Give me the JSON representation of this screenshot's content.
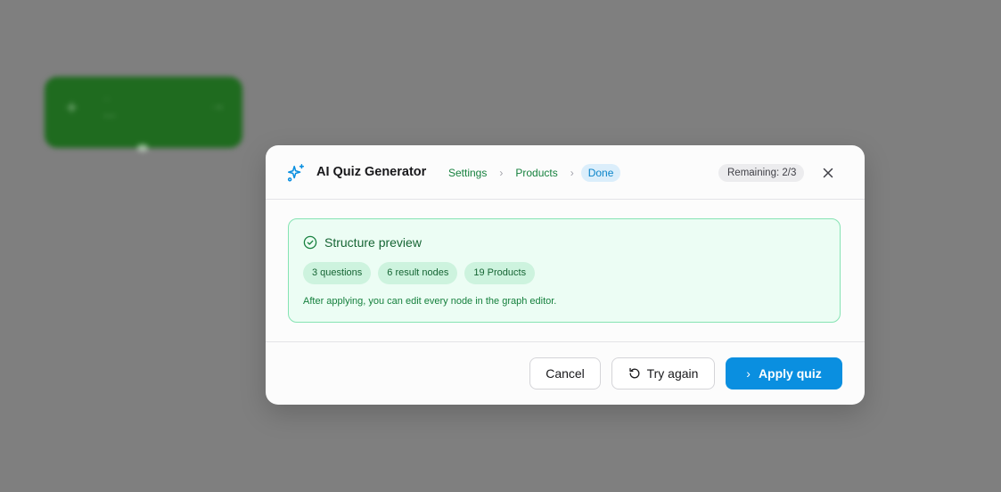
{
  "background": {
    "node": {
      "plus": "+",
      "small_label": "...",
      "title": "...",
      "arrow": "→"
    }
  },
  "modal": {
    "title": "AI Quiz Generator",
    "icon": "sparkles-icon",
    "steps": [
      {
        "label": "Settings",
        "state": "completed"
      },
      {
        "label": "Products",
        "state": "completed"
      },
      {
        "label": "Done",
        "state": "active"
      }
    ],
    "step_separator": "›",
    "remaining": "Remaining: 2/3",
    "close_icon": "close-icon"
  },
  "preview": {
    "title": "Structure preview",
    "icon": "check-circle-icon",
    "chips": [
      "3 questions",
      "6 result nodes",
      "19 Products"
    ],
    "note": "After applying, you can edit every node in the graph editor."
  },
  "footer": {
    "cancel_label": "Cancel",
    "retry_label": "Try again",
    "retry_icon": "rotate-ccw-icon",
    "apply_label": "Apply quiz",
    "apply_icon": "chevron-right-icon"
  },
  "colors": {
    "accent": "#0a8fe0",
    "success": "#15803d",
    "success_bg": "#ecfdf4",
    "overlay": "#7f7f7f"
  }
}
